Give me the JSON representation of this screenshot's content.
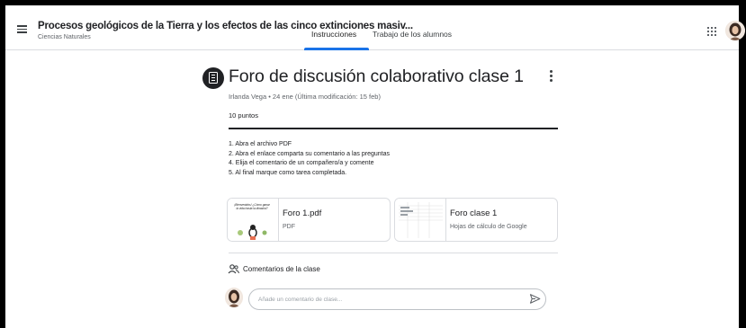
{
  "header": {
    "course_title": "Procesos geológicos de la Tierra y los efectos de las cinco extinciones masiv...",
    "course_section": "Ciencias Naturales",
    "tabs": [
      {
        "label": "Instrucciones",
        "selected": true
      },
      {
        "label": "Trabajo de los alumnos",
        "selected": false
      }
    ],
    "icons": {
      "menu": "menu-icon",
      "apps": "apps-grid-icon",
      "account": "user-avatar"
    }
  },
  "post": {
    "icon": "assignment-icon",
    "title": "Foro de discusión colaborativo clase 1",
    "meta": "Irlanda Vega • 24 ene (Última modificación: 15 feb)",
    "points": "10 puntos",
    "instructions": [
      "1. Abra el archivo PDF",
      "2. Abra el enlace comparta su comentario a las preguntas",
      "4. Elija el comentario de un compañero/a y comente",
      "5. Al final marque como tarea completada."
    ],
    "attachments": [
      {
        "title": "Foro 1.pdf",
        "type": "PDF",
        "thumb_text": "¡Bienvenidos! ¿Cómo ganar la vida hasta la dinastía?"
      },
      {
        "title": "Foro clase 1",
        "type": "Hojas de cálculo de Google"
      }
    ]
  },
  "comments": {
    "label": "Comentarios de la clase",
    "placeholder": "Añade un comentario de clase..."
  },
  "colors": {
    "accent": "#1a73e8",
    "text": "#202124",
    "muted": "#5f6368",
    "border": "#dadce0"
  }
}
